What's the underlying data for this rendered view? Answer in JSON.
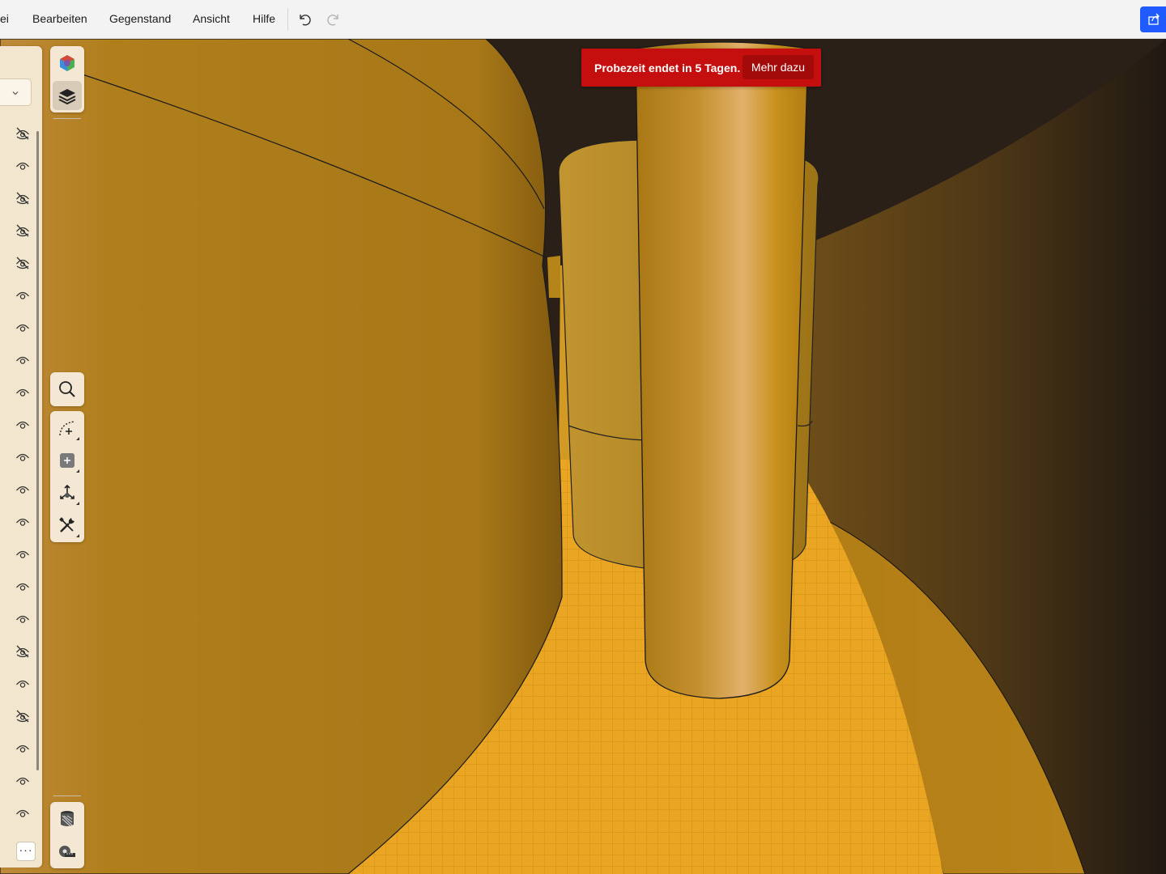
{
  "menu": {
    "items": [
      "ei",
      "Bearbeiten",
      "Gegenstand",
      "Ansicht",
      "Hilfe"
    ]
  },
  "toolbar_icons": {
    "undo": "undo-icon",
    "redo": "redo-icon",
    "share": "share-icon"
  },
  "banner": {
    "text": "Probezeit endet in 5 Tagen.",
    "button": "Mehr dazu",
    "color": "#c50f0f"
  },
  "layers": {
    "visibility": [
      false,
      true,
      false,
      false,
      false,
      true,
      true,
      true,
      true,
      true,
      true,
      true,
      true,
      true,
      true,
      true,
      false,
      true,
      false,
      true,
      true,
      true
    ],
    "more_label": "···"
  },
  "tools": {
    "top": [
      "material-cube-icon",
      "layers-icon"
    ],
    "middle": [
      "search-icon",
      "curve-add-icon",
      "add-shape-icon",
      "move-axes-icon",
      "tools-wrench-icon"
    ],
    "bottom": [
      "section-icon",
      "measure-tape-icon"
    ]
  },
  "scene": {
    "floor_color": "#e8a420",
    "wall_color": "#b0801a",
    "dark_color": "#2a2018"
  }
}
